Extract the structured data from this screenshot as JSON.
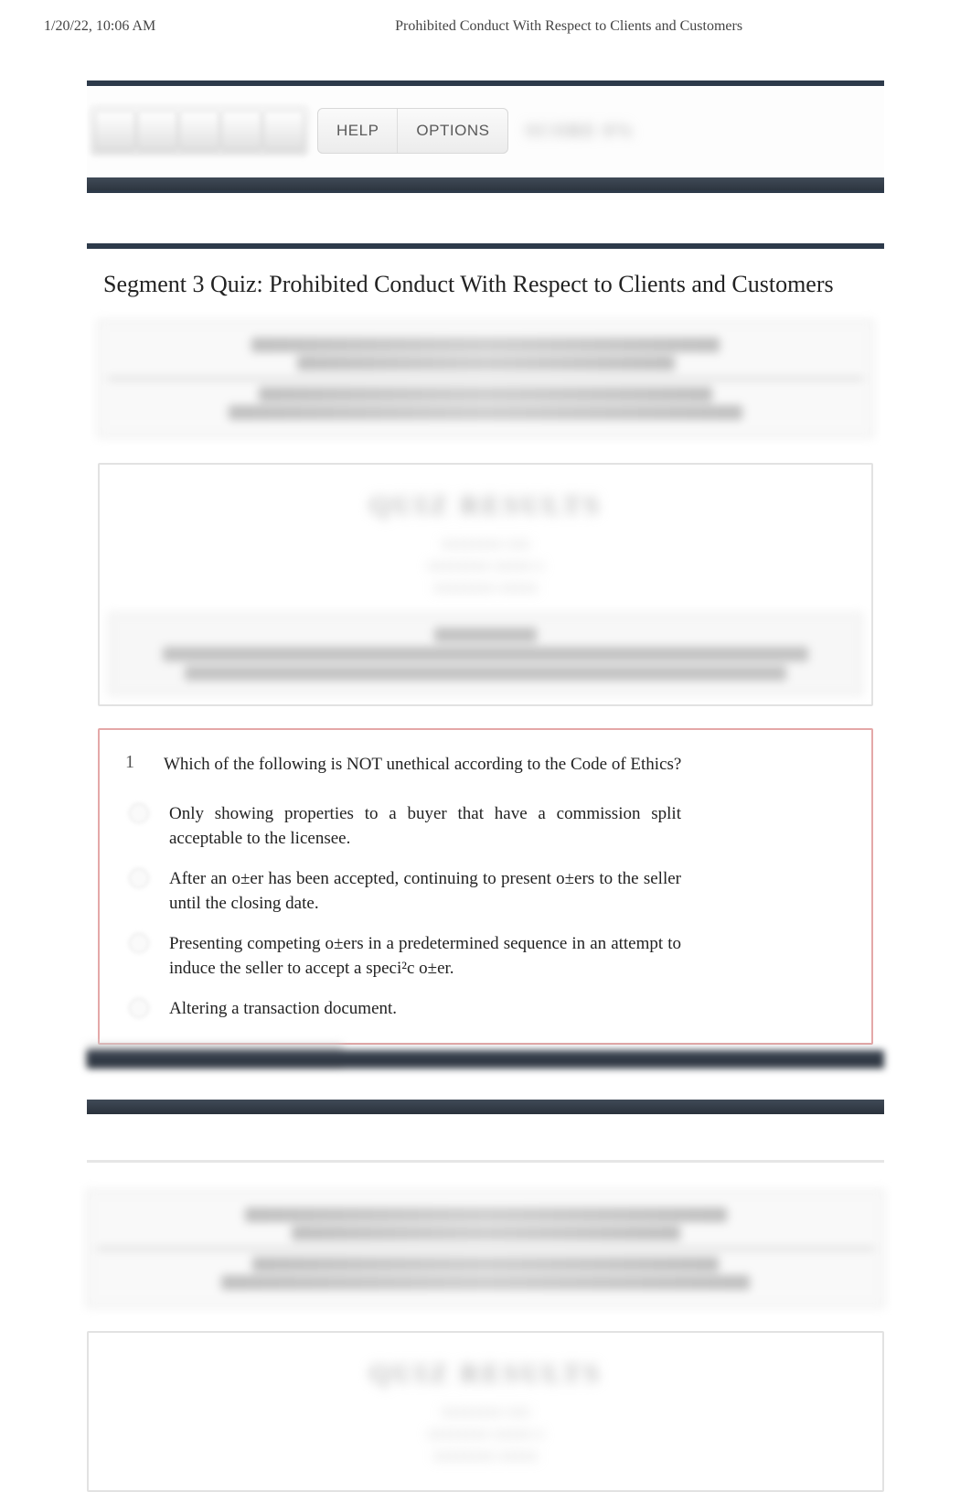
{
  "header": {
    "datetime": "1/20/22, 10:06 AM",
    "title": "Prohibited Conduct With Respect to Clients and Customers"
  },
  "toolbar": {
    "help": "HELP",
    "options": "OPTIONS",
    "score_obscured": "SCORE 0%"
  },
  "quiz": {
    "title": "Segment 3 Quiz: Prohibited Conduct With Respect to Clients and Customers"
  },
  "question": {
    "number": "1",
    "text": "Which of the following is NOT unethical according to the Code of Ethics?",
    "answers": [
      "Only showing properties to a buyer that have a commission split acceptable to the licensee.",
      "After an o±er has been accepted, continuing to present o±ers to the seller until the closing date.",
      "Presenting competing o±ers in a predetermined sequence in an attempt to induce the seller to accept a speci²c o±er.",
      "Altering a transaction document."
    ]
  }
}
